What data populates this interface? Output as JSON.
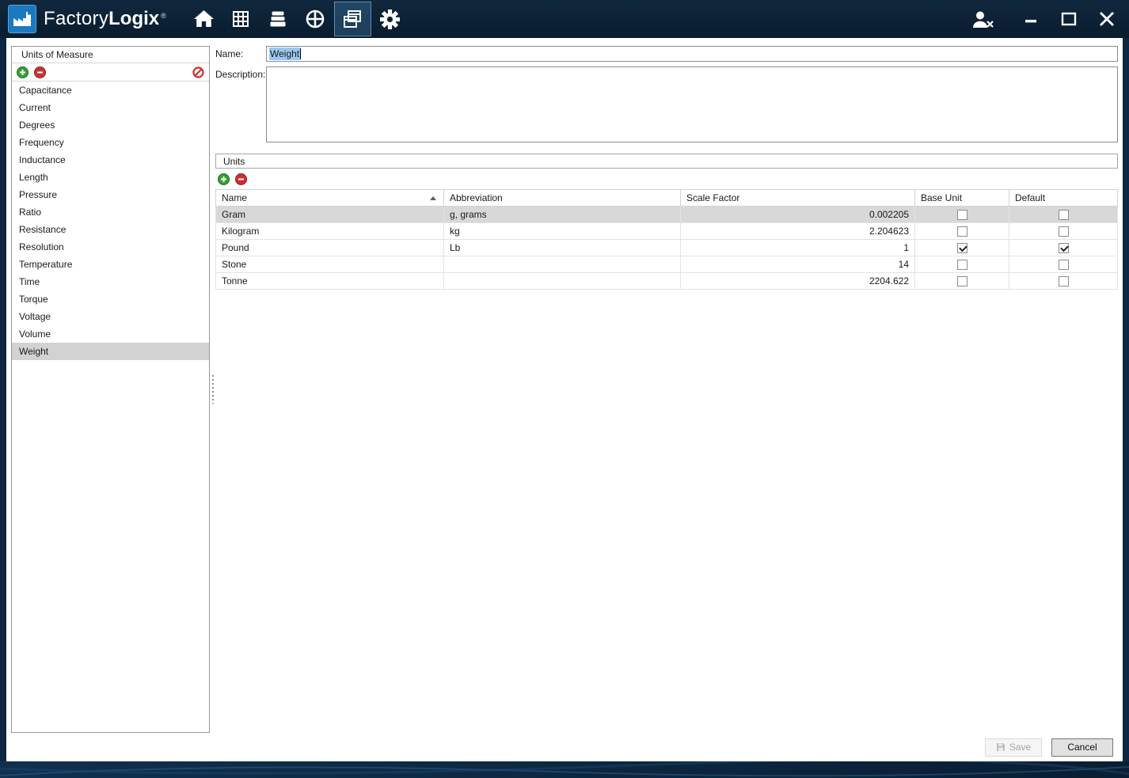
{
  "colors": {
    "titlebar_bg": "#0c2134",
    "accent_blue": "#1b79c0",
    "selection_highlight": "#9ac8f0",
    "selected_row_bg": "#d8d8d8",
    "add_green": "#35a035",
    "remove_red": "#c83232"
  },
  "titlebar": {
    "app_name_light": "Factory",
    "app_name_bold": "Logix",
    "registered_mark": "®",
    "nav_icons": [
      "home-icon",
      "grid-icon",
      "layers-icon",
      "target-icon",
      "forms-icon",
      "gear-icon"
    ],
    "active_nav": "forms-icon",
    "window_icons": [
      "user-logout-icon",
      "minimize-icon",
      "maximize-icon",
      "close-icon"
    ]
  },
  "sidebar": {
    "title": "Units of Measure",
    "toolbar_icons": [
      "plus-circle-icon",
      "minus-circle-icon",
      "slash-circle-icon"
    ],
    "items": [
      "Capacitance",
      "Current",
      "Degrees",
      "Frequency",
      "Inductance",
      "Length",
      "Pressure",
      "Ratio",
      "Resistance",
      "Resolution",
      "Temperature",
      "Time",
      "Torque",
      "Voltage",
      "Volume",
      "Weight"
    ],
    "selected_item": "Weight"
  },
  "form": {
    "name_label": "Name:",
    "name_value": "Weight",
    "description_label": "Description:",
    "description_value": ""
  },
  "units": {
    "title": "Units",
    "toolbar_icons": [
      "plus-circle-icon",
      "minus-circle-icon"
    ],
    "columns": [
      "Name",
      "Abbreviation",
      "Scale Factor",
      "Base Unit",
      "Default"
    ],
    "sorted_column": "Name",
    "sort_direction": "ascending",
    "rows": [
      {
        "name": "Gram",
        "abbreviation": "g, grams",
        "scale_factor": "0.002205",
        "base_unit": false,
        "default": false,
        "selected": true
      },
      {
        "name": "Kilogram",
        "abbreviation": "kg",
        "scale_factor": "2.204623",
        "base_unit": false,
        "default": false,
        "selected": false
      },
      {
        "name": "Pound",
        "abbreviation": "Lb",
        "scale_factor": "1",
        "base_unit": true,
        "default": true,
        "selected": false
      },
      {
        "name": "Stone",
        "abbreviation": "",
        "scale_factor": "14",
        "base_unit": false,
        "default": false,
        "selected": false
      },
      {
        "name": "Tonne",
        "abbreviation": "",
        "scale_factor": "2204.622",
        "base_unit": false,
        "default": false,
        "selected": false
      }
    ]
  },
  "footer": {
    "save_label": "Save",
    "cancel_label": "Cancel"
  }
}
